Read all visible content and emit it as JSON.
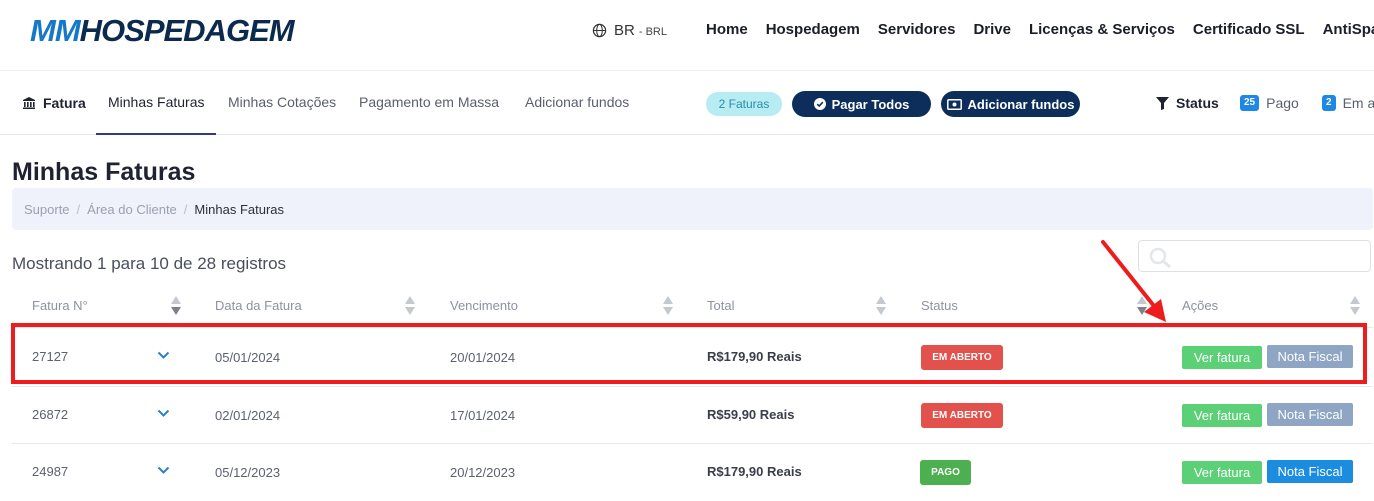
{
  "header": {
    "logo_prefix": "MM",
    "logo_rest": "HOSPEDAGEM",
    "lang_code": "BR",
    "lang_currency": "- BRL",
    "nav": [
      "Home",
      "Hospedagem",
      "Servidores",
      "Drive",
      "Licenças & Serviços",
      "Certificado SSL",
      "AntiSpam"
    ]
  },
  "subnav": {
    "title": "Fatura",
    "tabs": [
      "Minhas Faturas",
      "Minhas Cotações",
      "Pagamento em Massa",
      "Adicionar fundos"
    ],
    "active_tab": "Minhas Faturas",
    "invoice_count": "2 Faturas",
    "pay_all": "Pagar Todos",
    "add_funds": "Adicionar fundos",
    "status_label": "Status",
    "paid_count": "25",
    "paid_label": "Pago",
    "open_count": "2",
    "open_label": "Em a"
  },
  "page": {
    "title": "Minhas Faturas",
    "breadcrumb": [
      "Suporte",
      "Área do Cliente",
      "Minhas Faturas"
    ],
    "records": "Mostrando 1 para 10 de 28 registros",
    "search_placeholder": ""
  },
  "table": {
    "headers": [
      "Fatura N°",
      "Data da Fatura",
      "Vencimento",
      "Total",
      "Status",
      "Ações"
    ],
    "rows": [
      {
        "id": "27127",
        "date": "05/01/2024",
        "due": "20/01/2024",
        "total": "R$179,90 Reais",
        "status": "EM ABERTO",
        "view": "Ver fatura",
        "nota": "Nota Fiscal"
      },
      {
        "id": "26872",
        "date": "02/01/2024",
        "due": "17/01/2024",
        "total": "R$59,90 Reais",
        "status": "EM ABERTO",
        "view": "Ver fatura",
        "nota": "Nota Fiscal"
      },
      {
        "id": "24987",
        "date": "05/12/2023",
        "due": "20/12/2023",
        "total": "R$179,90 Reais",
        "status": "PAGO",
        "view": "Ver fatura",
        "nota": "Nota Fiscal"
      }
    ]
  },
  "colors": {
    "brand_dark": "#0c2a4e",
    "brand_blue": "#1679c8",
    "status_open": "#e2514c",
    "status_paid": "#4caf50",
    "view_button": "#5cd077",
    "annotation_red": "#ee1c1c"
  }
}
